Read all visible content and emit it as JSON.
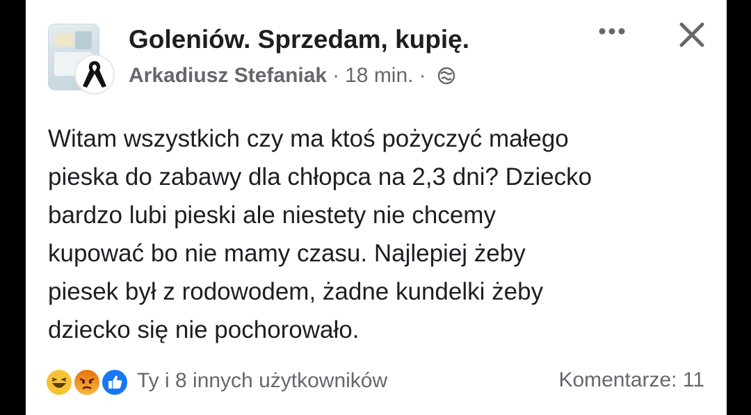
{
  "post": {
    "group_name": "Goleniów. Sprzedam, kupię.",
    "author": "Arkadiusz Stefaniak",
    "separator_1": "·",
    "time": "18 min.",
    "separator_2": "·",
    "privacy_icon": "globe-icon",
    "text": "Witam wszystkich czy ma ktoś pożyczyć małego\npieska do zabawy dla chłopca na 2,3 dni? Dziecko\nbardzo lubi pieski ale niestety nie chcemy\nkupować bo nie mamy czasu. Najlepiej żeby\npiesek był z rodowodem, żadne kundelki żeby\ndziecko się nie pochorowało."
  },
  "header_actions": {
    "more_icon": "more-options-icon",
    "close_icon": "close-icon"
  },
  "footer": {
    "reaction_icons": [
      "haha-reaction-icon",
      "angry-reaction-icon",
      "like-reaction-icon"
    ],
    "reactions_text": "Ty i 8 innych użytkowników",
    "comments_text": "Komentarze: 11"
  },
  "colors": {
    "text_primary": "#1c1e21",
    "text_secondary": "#65676b",
    "like_blue": "#1877f2",
    "haha_yellow": "#f7c336",
    "angry_orange": "#e9710f"
  }
}
